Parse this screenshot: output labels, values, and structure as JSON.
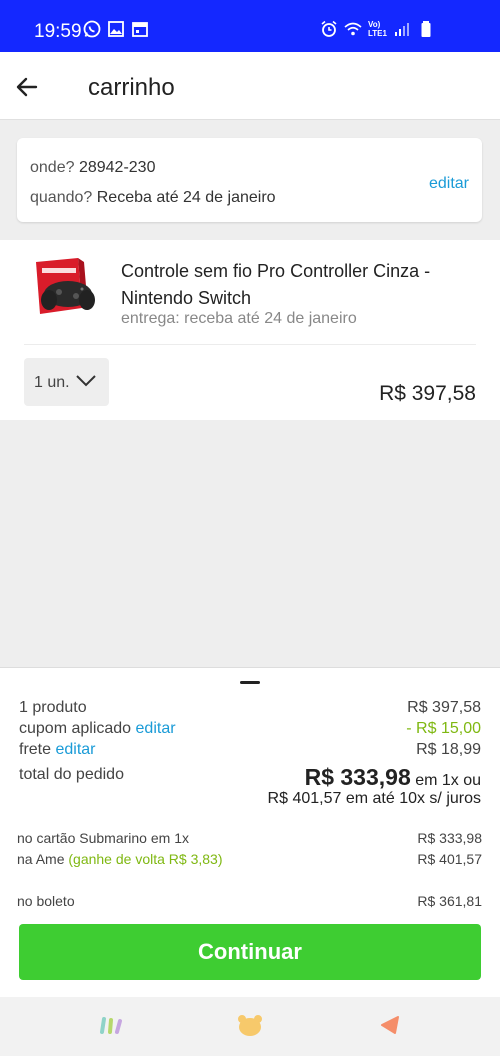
{
  "status_bar": {
    "time": "19:59",
    "net_label_top": "Vo)",
    "net_label_bottom": "LTE1"
  },
  "app_bar": {
    "title": "carrinho"
  },
  "delivery": {
    "where_label": "onde?",
    "where_value": "28942-230",
    "when_label": "quando?",
    "when_value": "Receba até 24 de janeiro",
    "edit_label": "editar"
  },
  "product": {
    "name": "Controle sem fio Pro Controller Cinza - Nintendo Switch",
    "delivery": "entrega: receba até 24 de janeiro",
    "quantity": "1 un.",
    "price": "R$ 397,58"
  },
  "summary": {
    "products_label": "1 produto",
    "products_value": "R$ 397,58",
    "coupon_label": "cupom aplicado",
    "coupon_edit": "editar",
    "coupon_value": "- R$ 15,00",
    "shipping_label": "frete",
    "shipping_edit": "editar",
    "shipping_value": "R$ 18,99",
    "total_label": "total do pedido",
    "total_value": "R$ 333,98",
    "total_suffix": "em 1x ou",
    "installments": "R$ 401,57 em até 10x s/ juros"
  },
  "payments": {
    "card_label": "no cartão Submarino em 1x",
    "card_value": "R$ 333,98",
    "ame_label": "na Ame",
    "ame_cashback": "(ganhe de volta R$ 3,83)",
    "ame_value": "R$ 401,57",
    "boleto_label": "no boleto",
    "boleto_value": "R$ 361,81"
  },
  "actions": {
    "continue_label": "Continuar"
  },
  "colors": {
    "status_bar": "#1428ff",
    "link": "#1a9bd7",
    "discount": "#7fb812",
    "continue_button": "#3ecd32"
  },
  "bottom_nav": {
    "icons": [
      "stripes-icon",
      "bear-icon",
      "triangle-icon"
    ]
  }
}
